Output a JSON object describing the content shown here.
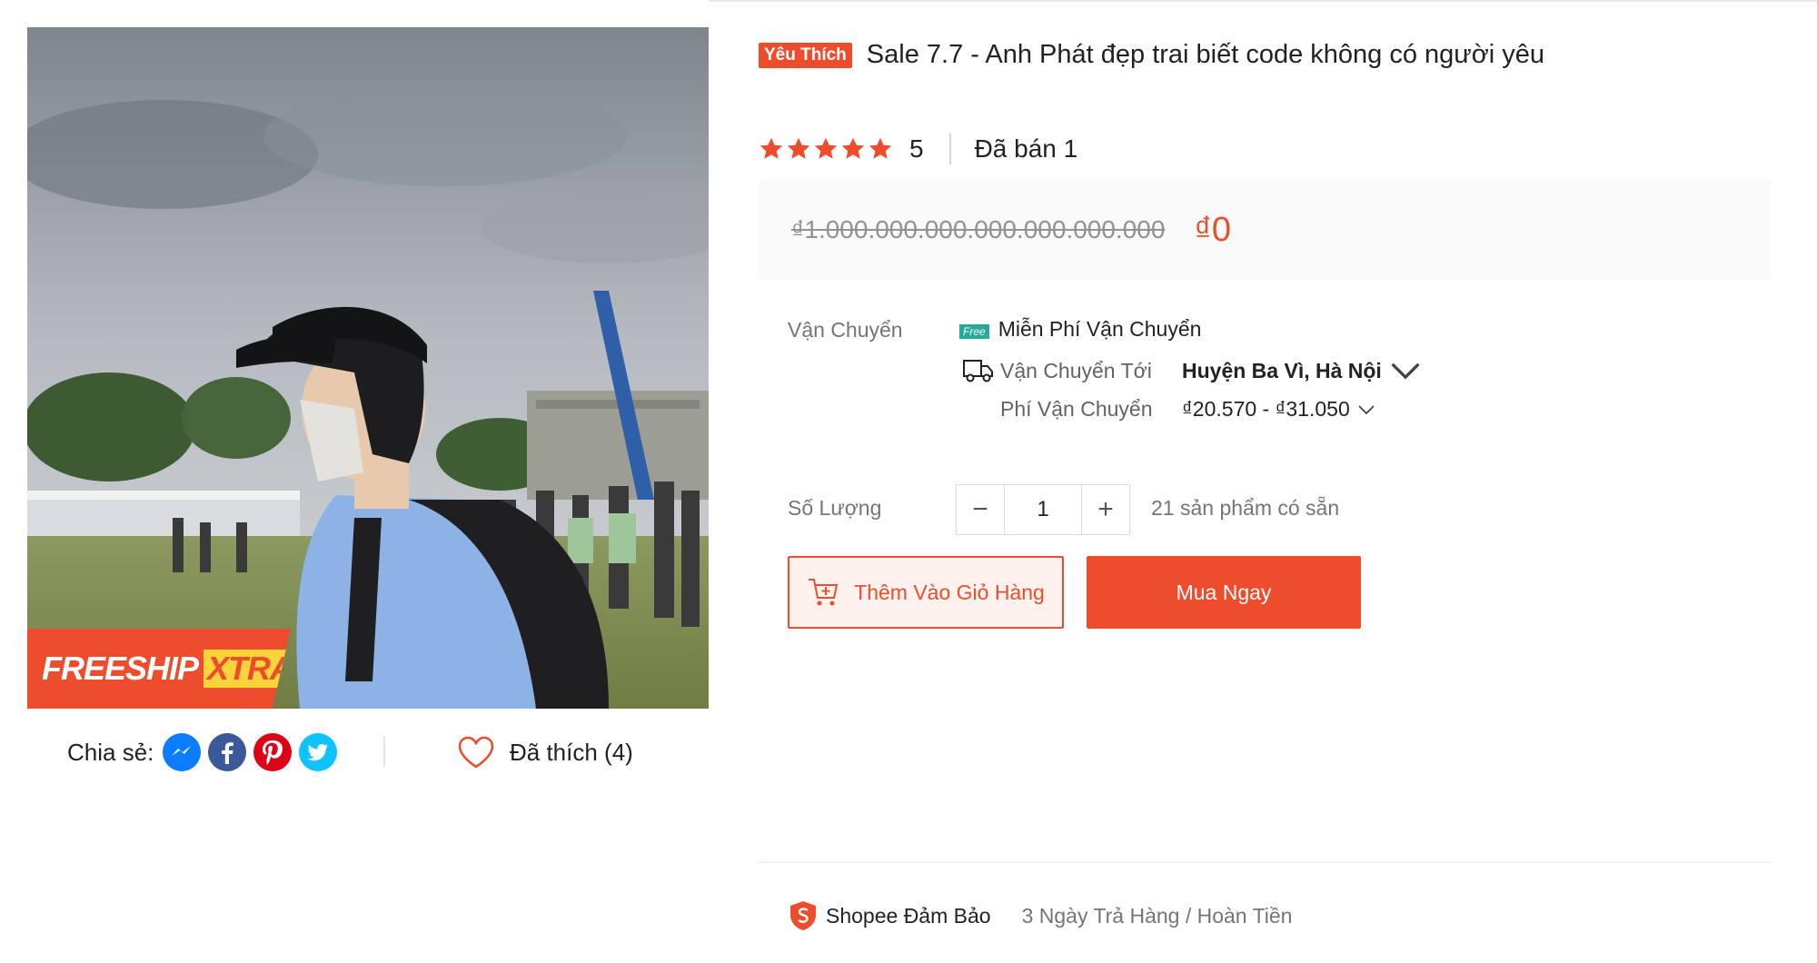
{
  "colors": {
    "accent": "#ee4d2d",
    "free_ship": "#26aa99",
    "star": "#ee4d2d"
  },
  "gallery": {
    "image_alt": "Product photo: person in black cap, face mask and blue shirt at an outdoor event",
    "freeship_label": "FREESHIP",
    "xtra_label": "XTRA"
  },
  "share": {
    "label": "Chia sẻ:",
    "icons": [
      "messenger-icon",
      "facebook-icon",
      "pinterest-icon",
      "twitter-icon"
    ]
  },
  "like": {
    "label": "Đã thích (4)",
    "icon": "heart-icon"
  },
  "product": {
    "badge": "Yêu Thích",
    "title": "Sale 7.7 - Anh Phát đẹp trai biết code không có người yêu",
    "rating": "5",
    "rating_stars": 5,
    "sold": "Đã bán 1",
    "old_price": "₫1.000.000.000.000.000.000.000",
    "price": "₫0"
  },
  "shipping": {
    "label": "Vận Chuyển",
    "free_tag": "Free",
    "free_text": "Miễn Phí Vận Chuyển",
    "destination_label": "Vận Chuyển Tới",
    "destination_value": "Huyện Ba Vì, Hà Nội",
    "fee_label": "Phí Vận Chuyển",
    "fee_value": "₫20.570 - ₫31.050"
  },
  "quantity": {
    "label": "Số Lượng",
    "minus": "−",
    "value": "1",
    "plus": "+",
    "stock": "21 sản phẩm có sẵn"
  },
  "actions": {
    "add_to_cart": "Thêm Vào Giỏ Hàng",
    "buy_now": "Mua Ngay"
  },
  "guarantee": {
    "label": "Shopee Đảm Bảo",
    "text": "3 Ngày Trả Hàng / Hoàn Tiền"
  }
}
